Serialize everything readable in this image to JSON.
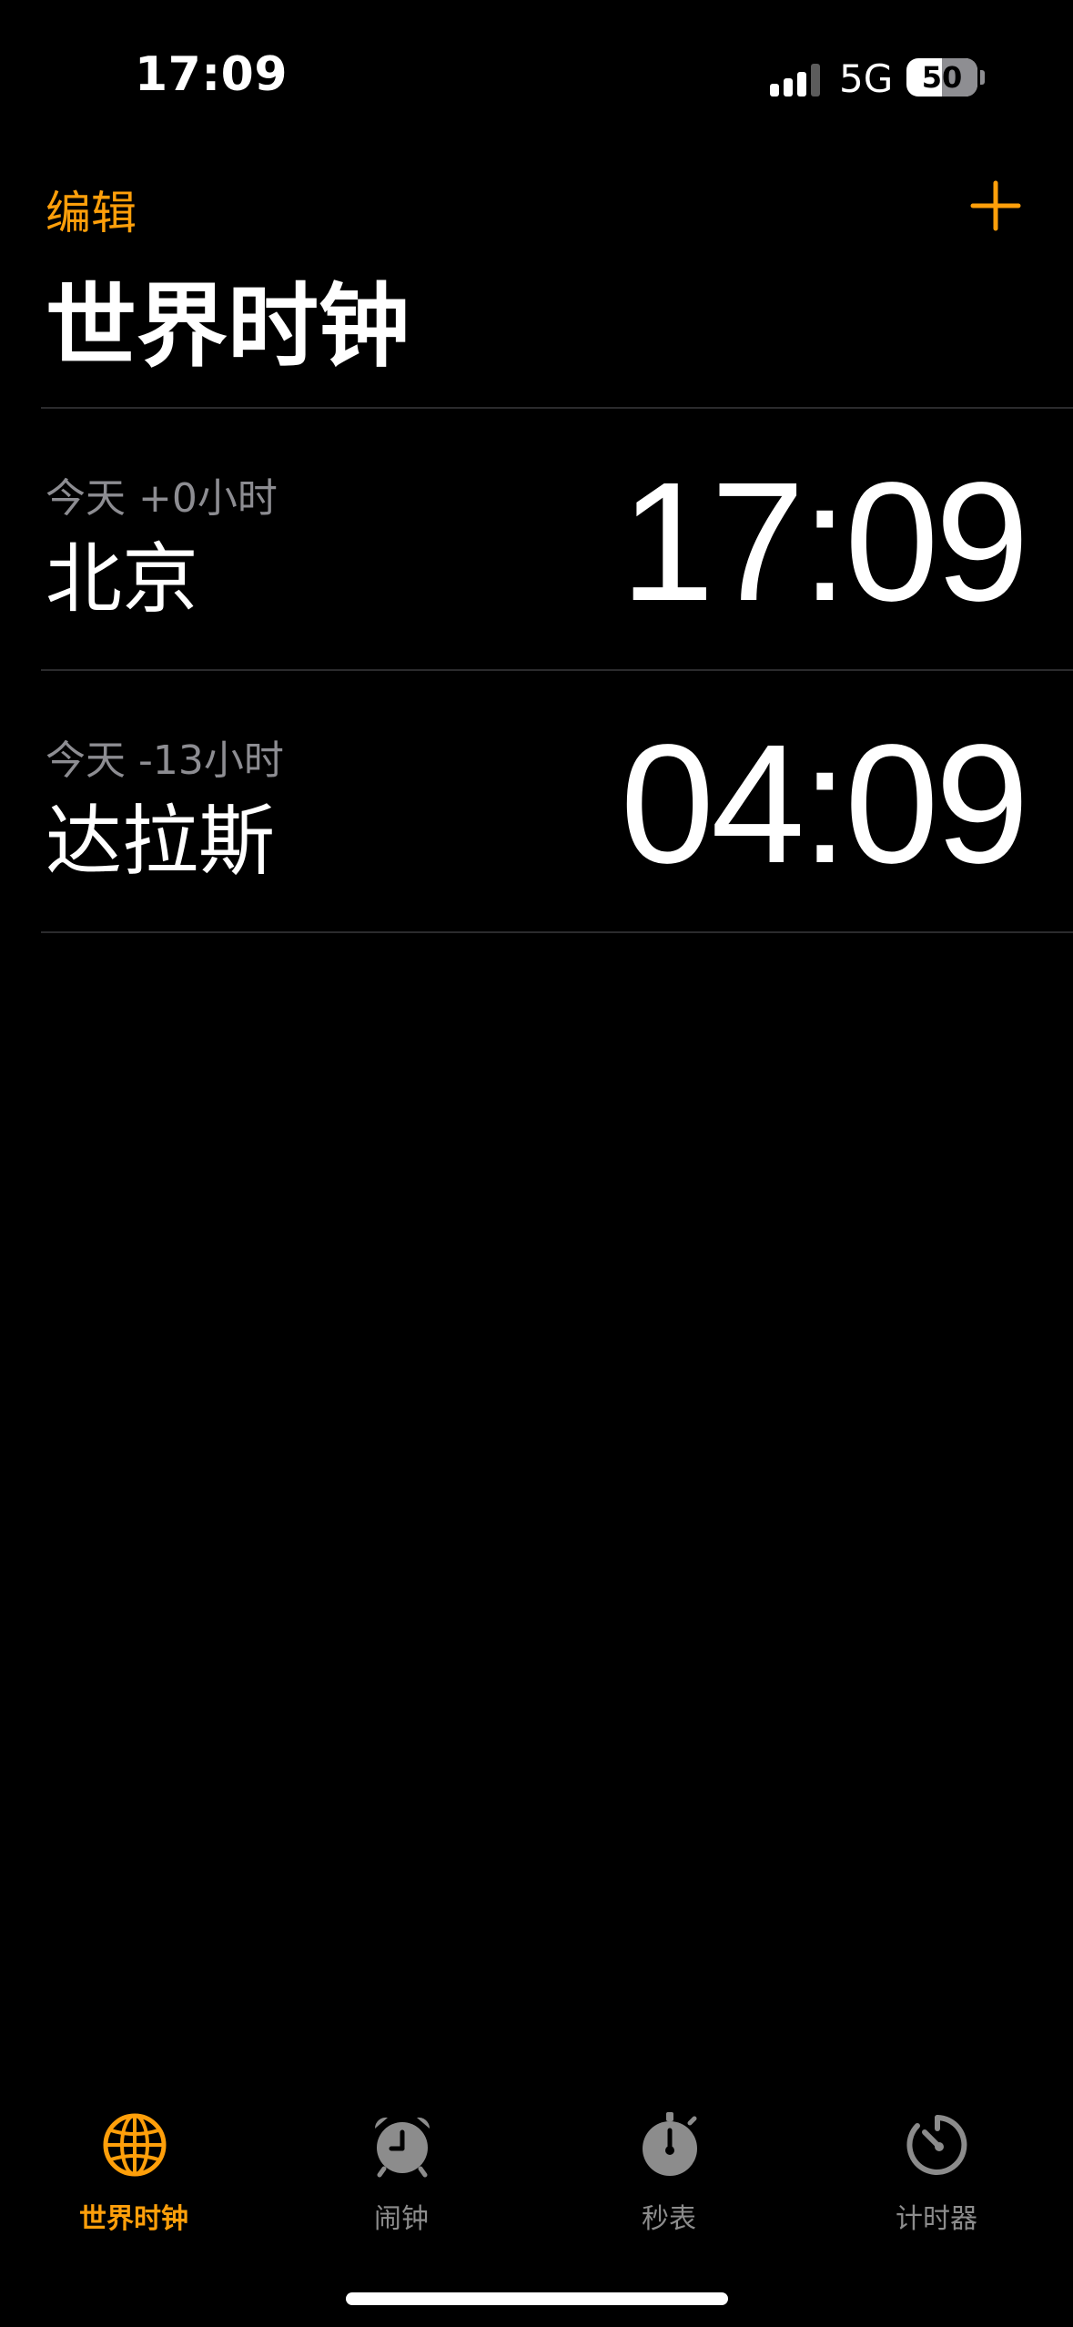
{
  "status_bar": {
    "time": "17:09",
    "network": "5G",
    "battery": "50",
    "battery_fraction": 0.5
  },
  "nav": {
    "edit_label": "编辑",
    "add_icon": "plus-icon"
  },
  "page_title": "世界时钟",
  "clocks": [
    {
      "offset": "今天 +0小时",
      "city": "北京",
      "time": "17:09"
    },
    {
      "offset": "今天 -13小时",
      "city": "达拉斯",
      "time": "04:09"
    }
  ],
  "tabs": [
    {
      "label": "世界时钟",
      "icon": "globe-icon",
      "active": true
    },
    {
      "label": "闹钟",
      "icon": "alarm-clock-icon",
      "active": false
    },
    {
      "label": "秒表",
      "icon": "stopwatch-icon",
      "active": false
    },
    {
      "label": "计时器",
      "icon": "timer-icon",
      "active": false
    }
  ],
  "colors": {
    "background": "#000000",
    "accent": "#ff9f0a",
    "primary_text": "#ffffff",
    "secondary_text": "#8d8d92",
    "inactive_tab": "#8c8c8c",
    "divider": "#2b2b2d"
  }
}
